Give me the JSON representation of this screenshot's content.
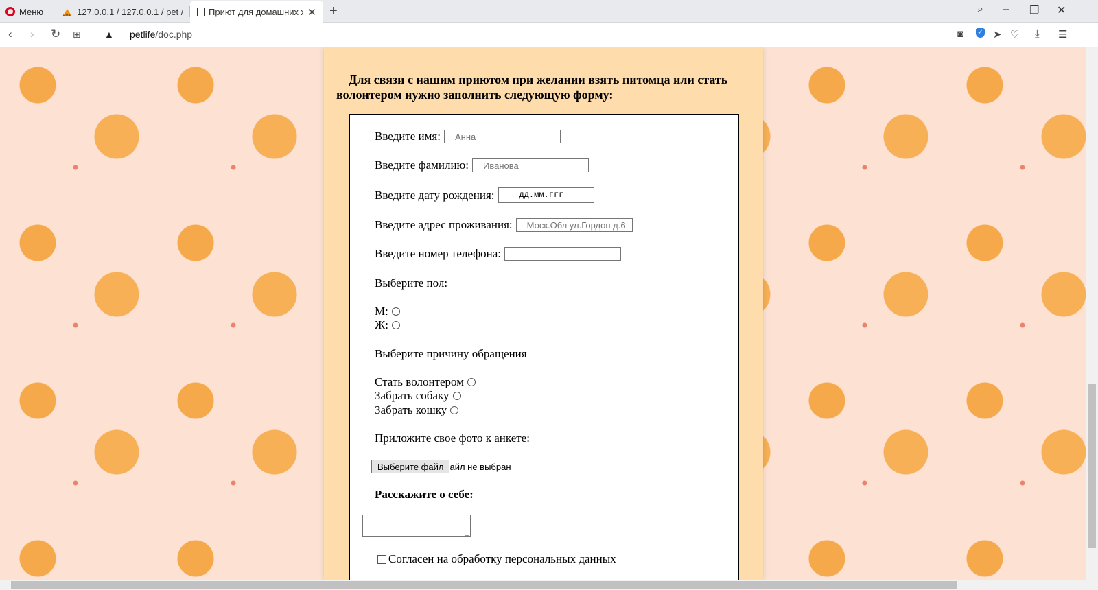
{
  "browser": {
    "menu_label": "Меню",
    "tabs": [
      {
        "title": "127.0.0.1 / 127.0.0.1 / pet /"
      },
      {
        "title": "Приют для домашних жив"
      }
    ],
    "url_host": "petlife",
    "url_path": "/doc.php"
  },
  "page": {
    "heading": "Для связи с нашим приютом при желании взять питомца или стать волонтером нужно заполнить следующую форму:",
    "form": {
      "first_name_label": "Введите имя:",
      "first_name_placeholder": "Анна",
      "last_name_label": "Введите фамилию:",
      "last_name_placeholder": "Иванова",
      "birthdate_label": "Введите дату рождения:",
      "birthdate_placeholder": "дд.мм.ггг",
      "address_label": "Введите адрес проживания:",
      "address_placeholder": "Моск.Обл ул.Гордон д.6",
      "phone_label": "Введите номер телефона:",
      "gender_label": "Выберите пол:",
      "gender_options": [
        "М:",
        "Ж:"
      ],
      "reason_label": "Выберите причину обращения",
      "reason_options": [
        "Стать волонтером",
        "Забрать собаку",
        "Забрать кошку"
      ],
      "photo_label": "Приложите свое фото к анкете:",
      "file_button": "Выберите файл",
      "file_status": "айл не выбран",
      "about_label": "Расскажите о себе:",
      "consent_label": "Согласен на обработку персональных данных"
    }
  }
}
